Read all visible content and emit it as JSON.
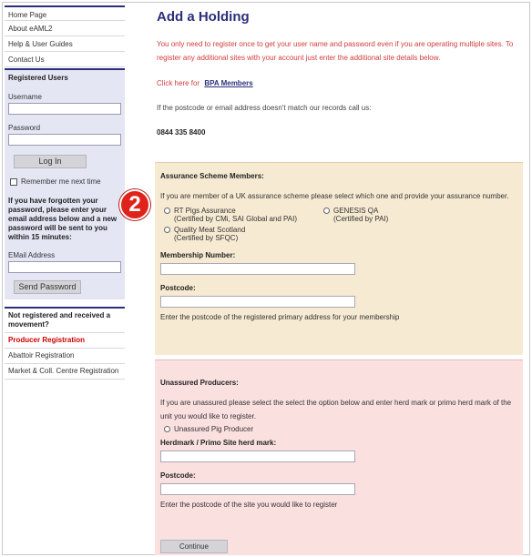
{
  "sidebar": {
    "nav": [
      "Home Page",
      "About eAML2",
      "Help & User Guides",
      "Contact Us"
    ],
    "login": {
      "heading": "Registered Users",
      "username_label": "Username",
      "password_label": "Password",
      "login_button": "Log In",
      "remember_label": "Remember me next time",
      "forgot_text": "If you have forgotten your password, please enter your email address below and a new password will be sent to you within 15 minutes:",
      "email_label": "EMail Address",
      "send_button": "Send Password"
    },
    "registration": {
      "heading": "Not registered and received a movement?",
      "items": [
        "Producer Registration",
        "Abattoir Registration",
        "Market & Coll. Centre Registration"
      ]
    }
  },
  "main": {
    "title": "Add a Holding",
    "intro": "You  only need to register once to get your user name and password even if you are operating multiple sites. To register any additional sites with your account just enter the additional site details below.",
    "click_prefix": "Click here for",
    "members_link": "BPA Members",
    "postcode_note": "If the postcode or email address doesn't match our records call us:",
    "phone": "0844 335 8400"
  },
  "assured": {
    "heading": "Assurance Scheme Members:",
    "text": "If you are member of a UK assurance scheme please select which one and provide your assurance number.",
    "options": [
      {
        "line1": "RT Pigs Assurance",
        "line2": "(Certified by CMi, SAI Global and PAI)"
      },
      {
        "line1": "GENESIS QA",
        "line2": "(Certified by PAI)"
      },
      {
        "line1": "Quality Meat Scotland",
        "line2": "(Certified by SFQC)"
      }
    ],
    "membership_label": "Membership Number:",
    "postcode_label": "Postcode:",
    "hint": "Enter the postcode of the registered primary address for your membership"
  },
  "unassured": {
    "heading": "Unassured Producers:",
    "text": "If you are unassured please select the select the option below and enter herd mark or primo herd mark of the unit you would like to register.",
    "option": "Unassured Pig Producer",
    "herdmark_label": "Herdmark / Primo Site herd mark:",
    "postcode_label": "Postcode:",
    "hint": "Enter the postcode of the site you would like to register",
    "continue_button": "Continue"
  },
  "step_badge": "2"
}
